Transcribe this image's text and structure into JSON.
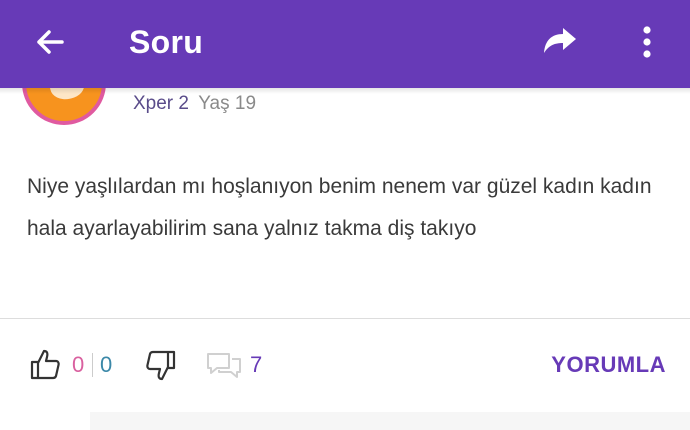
{
  "appbar": {
    "title": "Soru",
    "back_icon": "arrow-left-icon",
    "share_icon": "share-icon",
    "more_icon": "more-vert-icon"
  },
  "author": {
    "level": "Xper 2",
    "age": "Yaş 19",
    "avatar_border_color": "#e05aa0",
    "avatar_color": "#f7931e"
  },
  "content": {
    "text": "Niye yaşlılardan mı hoşlanıyon benim nenem var güzel kadın kadın hala ayarlayabilirim sana yalnız takma diş takıyo"
  },
  "actions": {
    "upvotes": "0",
    "downvotes": "0",
    "comment_count": "7",
    "comment_label": "YORUMLA",
    "like_icon": "thumbs-up-icon",
    "dislike_icon": "thumbs-down-icon",
    "comments_icon": "comments-icon"
  },
  "colors": {
    "accent": "#673ab7",
    "upvote": "#d9609f",
    "downvote": "#3b88a8"
  }
}
